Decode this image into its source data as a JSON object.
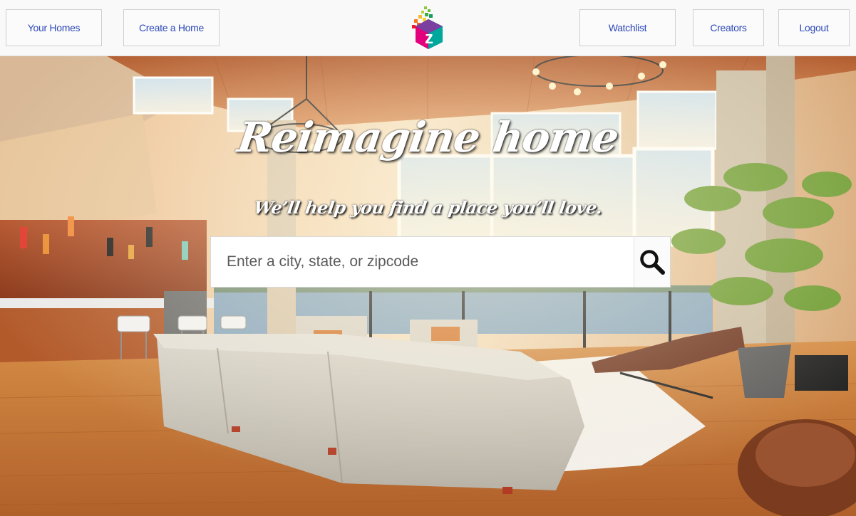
{
  "nav": {
    "left": [
      {
        "label": "Your Homes"
      },
      {
        "label": "Create a Home"
      }
    ],
    "right": [
      {
        "label": "Watchlist"
      },
      {
        "label": "Creators"
      },
      {
        "label": "Logout"
      }
    ],
    "logo": {
      "letter": "z",
      "icon": "brand-logo-icon"
    }
  },
  "hero": {
    "title": "Reimagine home",
    "subtitle": "We’ll help you find a place you’ll love.",
    "background": "living-room-photo"
  },
  "search": {
    "placeholder": "Enter a city, state, or zipcode",
    "value": "",
    "icon": "search-icon"
  },
  "colors": {
    "nav_text": "#2e49b8",
    "topbar_bg": "#f9f9fa"
  }
}
